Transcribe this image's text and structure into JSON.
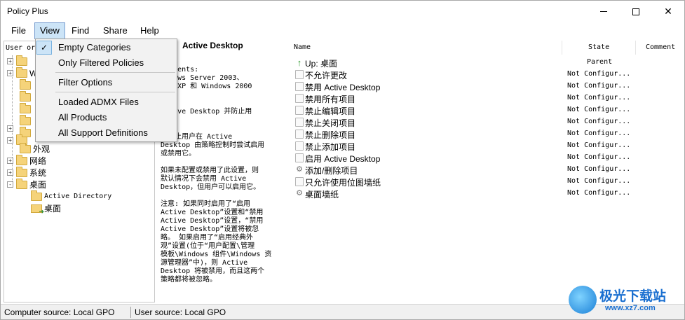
{
  "window": {
    "title": "Policy Plus"
  },
  "menubar": [
    "File",
    "View",
    "Find",
    "Share",
    "Help"
  ],
  "view_menu": {
    "items": [
      {
        "label": "Empty Categories",
        "checked": true
      },
      {
        "label": "Only Filtered Policies",
        "checked": false
      },
      {
        "label": "Filter Options",
        "checked": false
      },
      {
        "label": "Loaded ADMX Files",
        "checked": false
      },
      {
        "label": "All Products",
        "checked": false
      },
      {
        "label": "All Support Definitions",
        "checked": false
      }
    ]
  },
  "left_pane": {
    "header": "User or",
    "tree": [
      {
        "label": "",
        "expander": "+",
        "level": 0
      },
      {
        "label": "W",
        "expander": "+",
        "level": 0
      },
      {
        "label": "",
        "expander": "",
        "level": 1
      },
      {
        "label": "",
        "expander": "",
        "level": 1
      },
      {
        "label": "",
        "expander": "",
        "level": 1
      },
      {
        "label": "",
        "expander": "",
        "level": 1
      },
      {
        "label": "",
        "expander": "",
        "level": 1
      },
      {
        "label": "",
        "expander": "+",
        "level": 0
      },
      {
        "label": "",
        "expander": "+",
        "level": 0
      },
      {
        "label": "外观",
        "expander": "",
        "level": 1
      },
      {
        "label": "网络",
        "expander": "+",
        "level": 0
      },
      {
        "label": "系统",
        "expander": "+",
        "level": 0
      },
      {
        "label": "桌面",
        "expander": "-",
        "level": 0
      },
      {
        "label": "Active Directory",
        "expander": "",
        "level": 2
      },
      {
        "label": "桌面",
        "expander": "",
        "level": 2
      }
    ]
  },
  "middle_pane": {
    "title": "Active Desktop",
    "description": "irements:\nindows Server 2003、\nows XP 和 Windows 2000\n\n\nActive Desktop 并防止用\n用它。\n\n置防止用户在 Active\nDesktop 由策略控制时尝试启用\n或禁用它。\n\n如果未配置或禁用了此设置，则\n默认情况下会禁用 Active\nDesktop，但用户可以启用它。\n\n注意: 如果同时启用了“启用\nActive Desktop”设置和“禁用\nActive Desktop”设置，“禁用\nActive Desktop”设置将被忽\n略。 如果启用了“启用经典外\n观”设置(位于“用户配置\\管理\n模板\\Windows 组件\\Windows 资\n源管理器”中)，则 Active\nDesktop 将被禁用，而且这两个\n策略都将被忽略。"
  },
  "right_pane": {
    "columns": {
      "name": "Name",
      "state": "State",
      "comment": "Comment"
    },
    "rows": [
      {
        "icon": "up-arrow-icon",
        "name": "Up: 桌面",
        "state": "Parent"
      },
      {
        "icon": "doc-icon",
        "name": "不允许更改",
        "state": "Not Configur..."
      },
      {
        "icon": "doc-icon",
        "name": "禁用 Active Desktop",
        "state": "Not Configur..."
      },
      {
        "icon": "doc-icon",
        "name": "禁用所有项目",
        "state": "Not Configur..."
      },
      {
        "icon": "doc-icon",
        "name": "禁止编辑项目",
        "state": "Not Configur..."
      },
      {
        "icon": "doc-icon",
        "name": "禁止关闭项目",
        "state": "Not Configur..."
      },
      {
        "icon": "doc-icon",
        "name": "禁止删除项目",
        "state": "Not Configur..."
      },
      {
        "icon": "doc-icon",
        "name": "禁止添加项目",
        "state": "Not Configur..."
      },
      {
        "icon": "doc-icon",
        "name": "启用 Active Desktop",
        "state": "Not Configur..."
      },
      {
        "icon": "gear-icon",
        "name": "添加/删除项目",
        "state": "Not Configur..."
      },
      {
        "icon": "doc-icon",
        "name": "只允许使用位图墙纸",
        "state": "Not Configur..."
      },
      {
        "icon": "gear-icon",
        "name": "桌面墙纸",
        "state": "Not Configur..."
      }
    ]
  },
  "statusbar": {
    "computer_source": "Computer source:  Local GPO",
    "user_source": "User source:  Local GPO"
  },
  "watermark": {
    "line1": "极光下载站",
    "line2": "www.xz7.com"
  }
}
